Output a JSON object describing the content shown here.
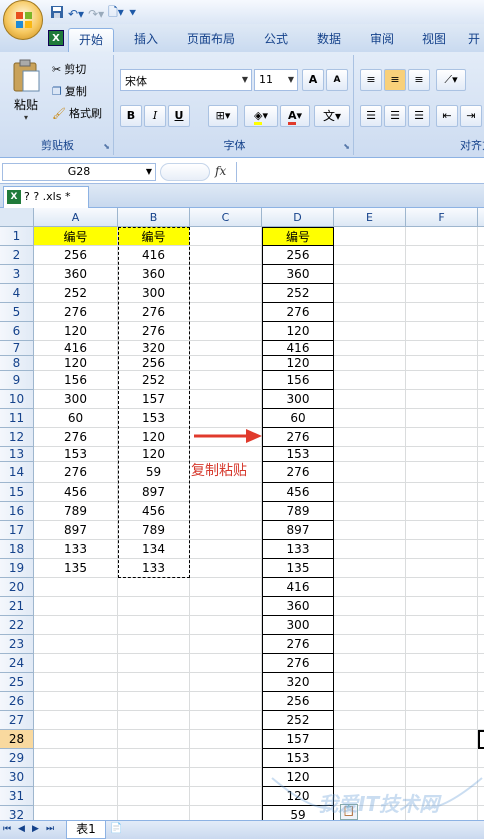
{
  "ribbon_tabs": [
    "开始",
    "插入",
    "页面布局",
    "公式",
    "数据",
    "审阅",
    "视图",
    "开"
  ],
  "clipboard": {
    "paste": "粘贴",
    "cut": "剪切",
    "copy": "复制",
    "format_painter": "格式刷",
    "group": "剪贴板"
  },
  "font": {
    "name": "宋体",
    "size": "11",
    "group": "字体",
    "bold": "B",
    "italic": "I",
    "underline": "U",
    "grow": "A",
    "shrink": "A",
    "wen": "文"
  },
  "align": {
    "group": "对齐方式"
  },
  "formula_bar": {
    "name_box": "G28",
    "fx": "fx",
    "value": ""
  },
  "workbook_tab": "? ? .xls *",
  "columns": [
    "A",
    "B",
    "C",
    "D",
    "E",
    "F"
  ],
  "rows": [
    "1",
    "2",
    "3",
    "4",
    "5",
    "6",
    "7",
    "8",
    "9",
    "10",
    "11",
    "12",
    "13",
    "14",
    "15",
    "16",
    "17",
    "18",
    "19",
    "20",
    "21",
    "22",
    "23",
    "24",
    "25",
    "26",
    "27",
    "28",
    "29",
    "30",
    "31",
    "32"
  ],
  "colA": [
    "编号",
    "256",
    "360",
    "252",
    "276",
    "120",
    "416",
    "120",
    "156",
    "300",
    "60",
    "276",
    "153",
    "276",
    "456",
    "789",
    "897",
    "133",
    "135"
  ],
  "colB": [
    "编号",
    "416",
    "360",
    "300",
    "276",
    "276",
    "320",
    "256",
    "252",
    "157",
    "153",
    "120",
    "120",
    "59",
    "897",
    "456",
    "789",
    "134",
    "133"
  ],
  "colD": [
    "编号",
    "256",
    "360",
    "252",
    "276",
    "120",
    "416",
    "120",
    "156",
    "300",
    "60",
    "276",
    "153",
    "276",
    "456",
    "789",
    "897",
    "133",
    "135",
    "416",
    "360",
    "300",
    "276",
    "276",
    "320",
    "256",
    "252",
    "157",
    "153",
    "120",
    "120",
    "59"
  ],
  "annotation": "复制粘贴",
  "sheet_tab": "表1",
  "watermark": "我爱IT技术网",
  "colors": {
    "header_fill": "#ffff00",
    "arrow": "#e03a2c",
    "selected_row": "#f9d99f"
  }
}
